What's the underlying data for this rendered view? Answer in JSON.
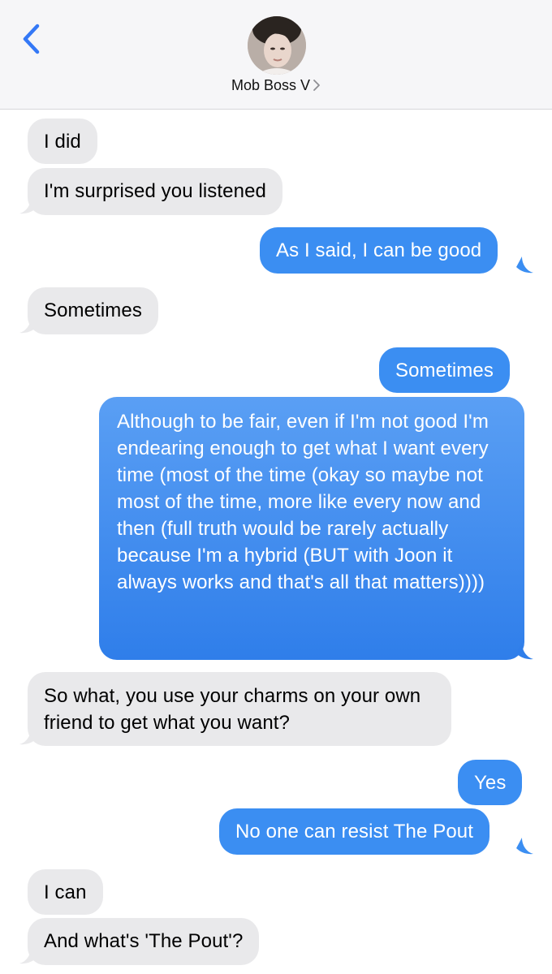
{
  "header": {
    "back_icon": "chevron-left-icon",
    "contact_name": "Mob Boss V",
    "contact_chevron": "chevron-right-icon"
  },
  "colors": {
    "incoming_bubble": "#e9e9eb",
    "outgoing_bubble": "#3b8ef2",
    "accent": "#3478f6"
  },
  "messages": [
    {
      "from": "them",
      "text": "I did"
    },
    {
      "from": "them",
      "text": "I'm surprised you listened"
    },
    {
      "from": "me",
      "text": "As I said, I can be good"
    },
    {
      "from": "them",
      "text": "Sometimes"
    },
    {
      "from": "me",
      "text": "Sometimes"
    },
    {
      "from": "me",
      "text": "Although to be fair, even if I'm not good I'm endearing enough to get what I want every time (most of the time (okay so maybe not most of the time, more like every now and then (full truth would be rarely actually because I'm a hybrid (BUT with Joon it always works and that's all that matters))))"
    },
    {
      "from": "them",
      "text": "So what, you use your charms on your own friend to get what you want?"
    },
    {
      "from": "me",
      "text": "Yes"
    },
    {
      "from": "me",
      "text": "No one can resist The Pout"
    },
    {
      "from": "them",
      "text": "I can"
    },
    {
      "from": "them",
      "text": "And what's 'The Pout'?"
    }
  ]
}
